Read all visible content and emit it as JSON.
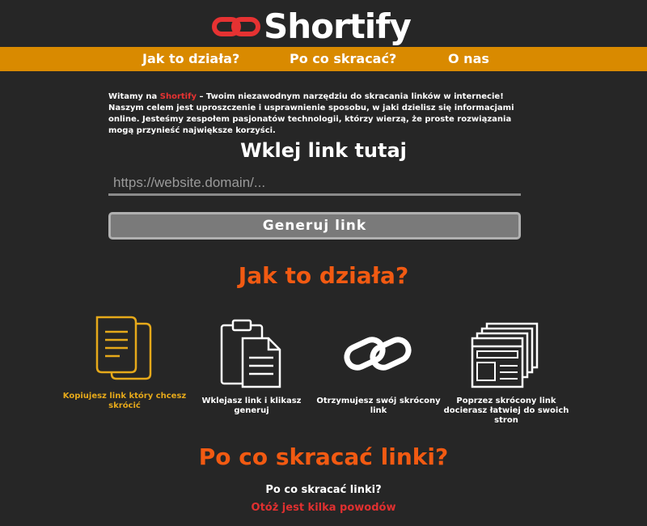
{
  "header": {
    "logo_text": "Shortify",
    "logo_icon": "chain-link-icon"
  },
  "nav": {
    "items": [
      "Jak to działa?",
      "Po co skracać?",
      "O nas"
    ]
  },
  "intro": {
    "prefix": "Witamy na ",
    "brand": "Shortify",
    "text": " – Twoim niezawodnym narzędziu do skracania linków w internecie! Naszym celem jest uproszczenie i usprawnienie sposobu, w jaki dzielisz się informacjami online. Jesteśmy zespołem pasjonatów technologii, którzy wierzą, że proste rozwiązania mogą przynieść największe korzyści."
  },
  "shortener": {
    "title": "Wklej link tutaj",
    "placeholder": "https://website.domain/...",
    "value": "",
    "button_label": "Generuj link"
  },
  "how": {
    "title": "Jak to działa?",
    "steps": [
      {
        "label": "Kopiujesz link który chcesz skrócić",
        "icon": "copy-documents-icon",
        "highlighted": true
      },
      {
        "label": "Wklejasz link i klikasz generuj",
        "icon": "clipboard-paste-icon",
        "highlighted": false
      },
      {
        "label": "Otrzymujesz swój skrócony link",
        "icon": "chain-link-icon",
        "highlighted": false
      },
      {
        "label": "Poprzez skrócony link docierasz łatwiej do swoich stron",
        "icon": "web-pages-icon",
        "highlighted": false
      }
    ]
  },
  "why": {
    "title": "Po co skracać linki?",
    "question": "Po co skracać linki?",
    "reasons_link": "Otóż jest kilka powodów"
  },
  "colors": {
    "background": "#262626",
    "nav_bar": "#d98a00",
    "accent_orange": "#f25a12",
    "accent_red": "#e63232",
    "highlight_gold": "#e6a91a"
  }
}
